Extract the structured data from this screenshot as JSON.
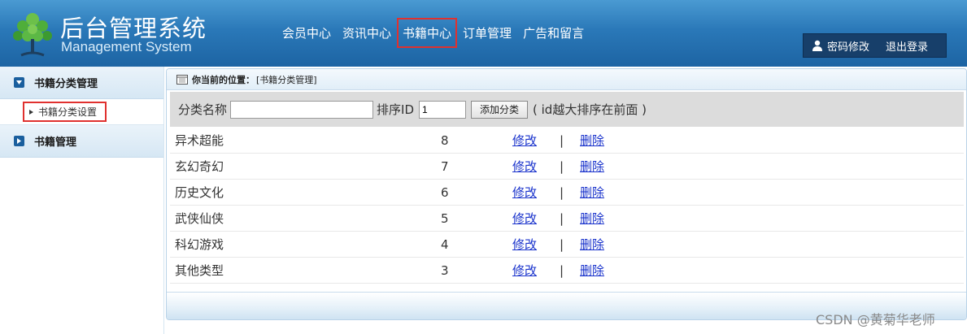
{
  "header": {
    "title": "后台管理系统",
    "subtitle": "Management System",
    "nav": [
      {
        "label": "会员中心"
      },
      {
        "label": "资讯中心"
      },
      {
        "label": "书籍中心"
      },
      {
        "label": "订单管理"
      },
      {
        "label": "广告和留言"
      }
    ],
    "active_nav": "书籍中心",
    "user": {
      "change_password": "密码修改",
      "logout": "退出登录"
    }
  },
  "sidebar": {
    "groups": [
      {
        "label": "书籍分类管理",
        "items": [
          {
            "label": "书籍分类设置"
          }
        ]
      },
      {
        "label": "书籍管理"
      }
    ]
  },
  "main": {
    "location_label": "你当前的位置：",
    "location_value": "[书籍分类管理]",
    "form": {
      "name_label": "分类名称",
      "name_value": "",
      "sort_label": "排序ID",
      "sort_value": "1",
      "add_button": "添加分类",
      "hint": "( id越大排序在前面 )"
    },
    "rows": [
      {
        "name": "异术超能",
        "id": "8",
        "edit": "修改",
        "sep": "|",
        "del": "删除"
      },
      {
        "name": "玄幻奇幻",
        "id": "7",
        "edit": "修改",
        "sep": "|",
        "del": "删除"
      },
      {
        "name": "历史文化",
        "id": "6",
        "edit": "修改",
        "sep": "|",
        "del": "删除"
      },
      {
        "name": "武侠仙侠",
        "id": "5",
        "edit": "修改",
        "sep": "|",
        "del": "删除"
      },
      {
        "name": "科幻游戏",
        "id": "4",
        "edit": "修改",
        "sep": "|",
        "del": "删除"
      },
      {
        "name": "其他类型",
        "id": "3",
        "edit": "修改",
        "sep": "|",
        "del": "删除"
      }
    ]
  },
  "watermark": "CSDN @黄菊华老师",
  "colors": {
    "header_bg": "#2a78b8",
    "highlight": "#e0312f",
    "link": "#1a33cc"
  }
}
